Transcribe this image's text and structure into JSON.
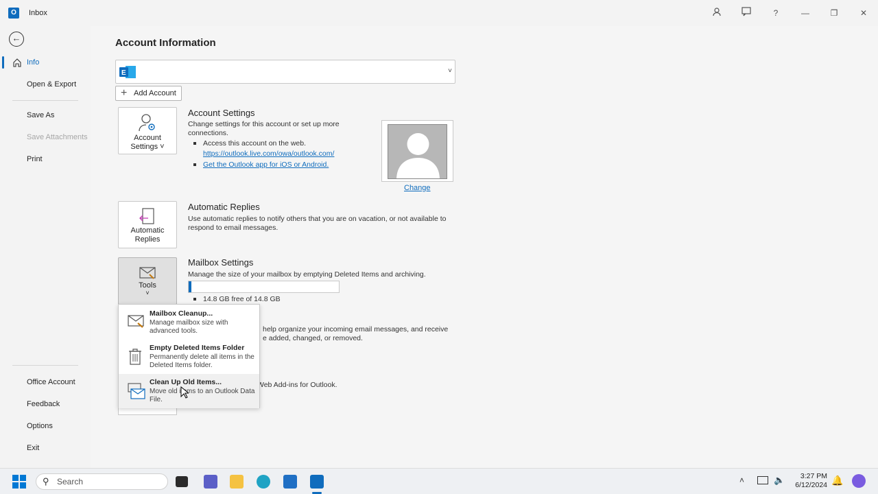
{
  "window": {
    "title": "Inbox"
  },
  "sidebar": {
    "items": [
      {
        "label": "Info"
      },
      {
        "label": "Open & Export"
      },
      {
        "label": "Save As"
      },
      {
        "label": "Save Attachments"
      },
      {
        "label": "Print"
      },
      {
        "label": "Office Account"
      },
      {
        "label": "Feedback"
      },
      {
        "label": "Options"
      },
      {
        "label": "Exit"
      }
    ]
  },
  "main": {
    "title": "Account Information",
    "add_account": "Add Account",
    "account_settings": {
      "button_label_line1": "Account",
      "button_label_line2": "Settings ˅",
      "title": "Account Settings",
      "desc": "Change settings for this account or set up more connections.",
      "bullet1": "Access this account on the web.",
      "link1": "https://outlook.live.com/owa/outlook.com/",
      "link2": "Get the Outlook app for iOS or Android.",
      "change_link": "Change"
    },
    "auto_replies": {
      "button_label_line1": "Automatic",
      "button_label_line2": "Replies",
      "title": "Automatic Replies",
      "desc": "Use automatic replies to notify others that you are on vacation, or not available to respond to email messages."
    },
    "mailbox": {
      "button_label": "Tools",
      "title": "Mailbox Settings",
      "desc": "Manage the size of your mailbox by emptying Deleted Items and archiving.",
      "quota_text": "14.8 GB free of 14.8 GB",
      "used_fraction": 0.02
    },
    "rules_desc_partial_line1": "help organize your incoming email messages, and receive",
    "rules_desc_partial_line2": "e added, changed, or removed.",
    "addins_desc_partial": "Web Add-ins for Outlook."
  },
  "tools_menu": [
    {
      "title": "Mailbox Cleanup...",
      "desc": "Manage mailbox size with advanced tools."
    },
    {
      "title": "Empty Deleted Items Folder",
      "desc": "Permanently delete all items in the Deleted Items folder."
    },
    {
      "title": "Clean Up Old Items...",
      "desc": "Move old items to an Outlook Data File."
    }
  ],
  "taskbar": {
    "search_placeholder": "Search",
    "time": "3:27 PM",
    "date": "6/12/2024"
  },
  "colors": {
    "accent": "#0f6cbd"
  }
}
